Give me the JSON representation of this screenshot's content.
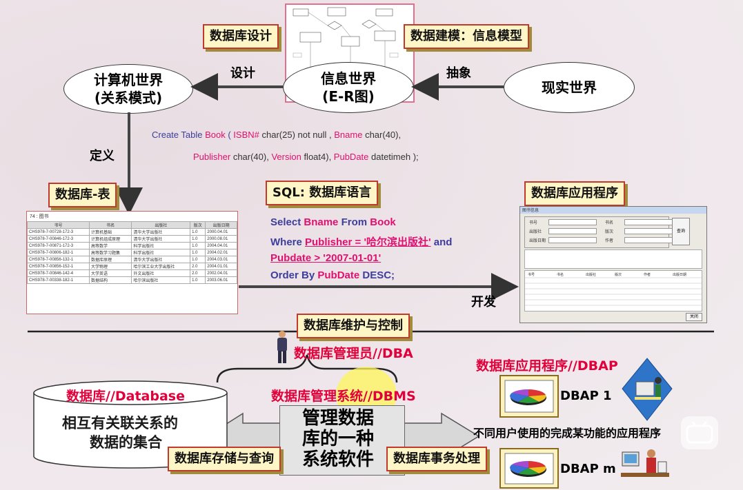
{
  "colors": {
    "label_fill": "#fff6c8",
    "label_border": "#c0392b",
    "red_text": "#e2003a",
    "sql_blue": "#3d3d9c",
    "sql_red": "#e0106f"
  },
  "labels": {
    "db_design": "数据库设计",
    "data_modeling": "数据建模：信息模型",
    "db_table": "数据库-表",
    "sql_lang": "SQL: 数据库语言",
    "db_app": "数据库应用程序",
    "db_maintenance": "数据库维护与控制",
    "db_storage": "数据库存储与查询",
    "db_transaction": "数据库事务处理"
  },
  "worlds": {
    "computer": {
      "line1": "计算机世界",
      "line2": "(关系模式)"
    },
    "info": {
      "line1": "信息世界",
      "line2": "(E-R图)"
    },
    "real": {
      "line1": "现实世界"
    }
  },
  "arrows": {
    "design": "设计",
    "abstract": "抽象",
    "define": "定义",
    "develop": "开发"
  },
  "create_sql": {
    "line1": [
      [
        "kw",
        "Create Table "
      ],
      [
        "red",
        "Book"
      ],
      [
        "kw",
        " ( "
      ],
      [
        "red",
        "ISBN#"
      ],
      [
        "txt",
        " char(25)  not null , "
      ],
      [
        "red",
        "Bname"
      ],
      [
        "txt",
        " char(40),"
      ]
    ],
    "line2": [
      [
        "red",
        "Publisher"
      ],
      [
        "txt",
        " char(40), "
      ],
      [
        "red",
        "Version"
      ],
      [
        "txt",
        " float4), "
      ],
      [
        "red",
        "PubDate"
      ],
      [
        "txt",
        " datetimeh );"
      ]
    ]
  },
  "select_sql": {
    "l1": [
      [
        "b",
        "Select "
      ],
      [
        "r",
        "Bname"
      ],
      [
        "b",
        " From "
      ],
      [
        "r",
        "Book"
      ]
    ],
    "l2": [
      [
        "b",
        "Where "
      ],
      [
        "ru",
        "Publisher = '哈尔滨出版社'"
      ],
      [
        "b",
        " and"
      ]
    ],
    "l3": [
      [
        "ru",
        "Pubdate > '2007-01-01'"
      ]
    ],
    "l4": [
      [
        "b",
        "Order By "
      ],
      [
        "r",
        "PubDate"
      ],
      [
        "b",
        " DESC;"
      ]
    ]
  },
  "book_table": {
    "caption": "74 : 图书",
    "headers": [
      "书号",
      "书名",
      "出版社",
      "版次",
      "出版日期"
    ],
    "rows": [
      [
        "CHS978-7-00728-172-3",
        "计算机基础",
        "清华大学出版社",
        "1.0",
        "2000.04.01"
      ],
      [
        "CHS978-7-00846-172-3",
        "计算机组成原理",
        "清华大学出版社",
        "1.0",
        "2000.08.01"
      ],
      [
        "CHS978-7-00871-172-3",
        "高等数学",
        "科学出版社",
        "1.0",
        "2004.04.01"
      ],
      [
        "CHS978-7-00806-182-1",
        "高等数学习题集",
        "科学出版社",
        "1.0",
        "2004.02.01"
      ],
      [
        "CHS978-7-00856-132-1",
        "数据库原理",
        "清华大学出版社",
        "1.0",
        "2004.03.01"
      ],
      [
        "CHS978-7-00856-152-1",
        "大学物理",
        "哈尔滨工业大学出版社",
        "2.0",
        "2004.01.01"
      ],
      [
        "CHS978-7-00846-142-4",
        "大学英语",
        "外文出版社",
        "2.0",
        "2002.04.01"
      ],
      [
        "CHS978-7-00338-182-1",
        "数据结构",
        "哈尔滨出版社",
        "1.0",
        "2003.06.01"
      ]
    ]
  },
  "app_form": {
    "title": "图书信息",
    "button": "查询",
    "close": "关闭",
    "fields": [
      "书号",
      "书名",
      "出版社",
      "版次",
      "出版日期",
      "作者"
    ],
    "grid_headers": [
      "书号",
      "书名",
      "出版社",
      "版次",
      "作者",
      "出版日期"
    ]
  },
  "roles": {
    "dba": "数据库管理员//DBA",
    "dbms": "数据库管理系统//DBMS",
    "database": "数据库//Database",
    "dbap": "数据库应用程序//DBAP"
  },
  "database_desc": {
    "line1": "相互有关联关系的",
    "line2": "数据的集合"
  },
  "dbms_desc": {
    "line1": "管理数据",
    "line2": "库的一种",
    "line3": "系统软件"
  },
  "dbap": {
    "app1": "DBAP 1",
    "appm": "DBAP m",
    "desc": "不同用户使用的完成某功能的应用程序"
  }
}
